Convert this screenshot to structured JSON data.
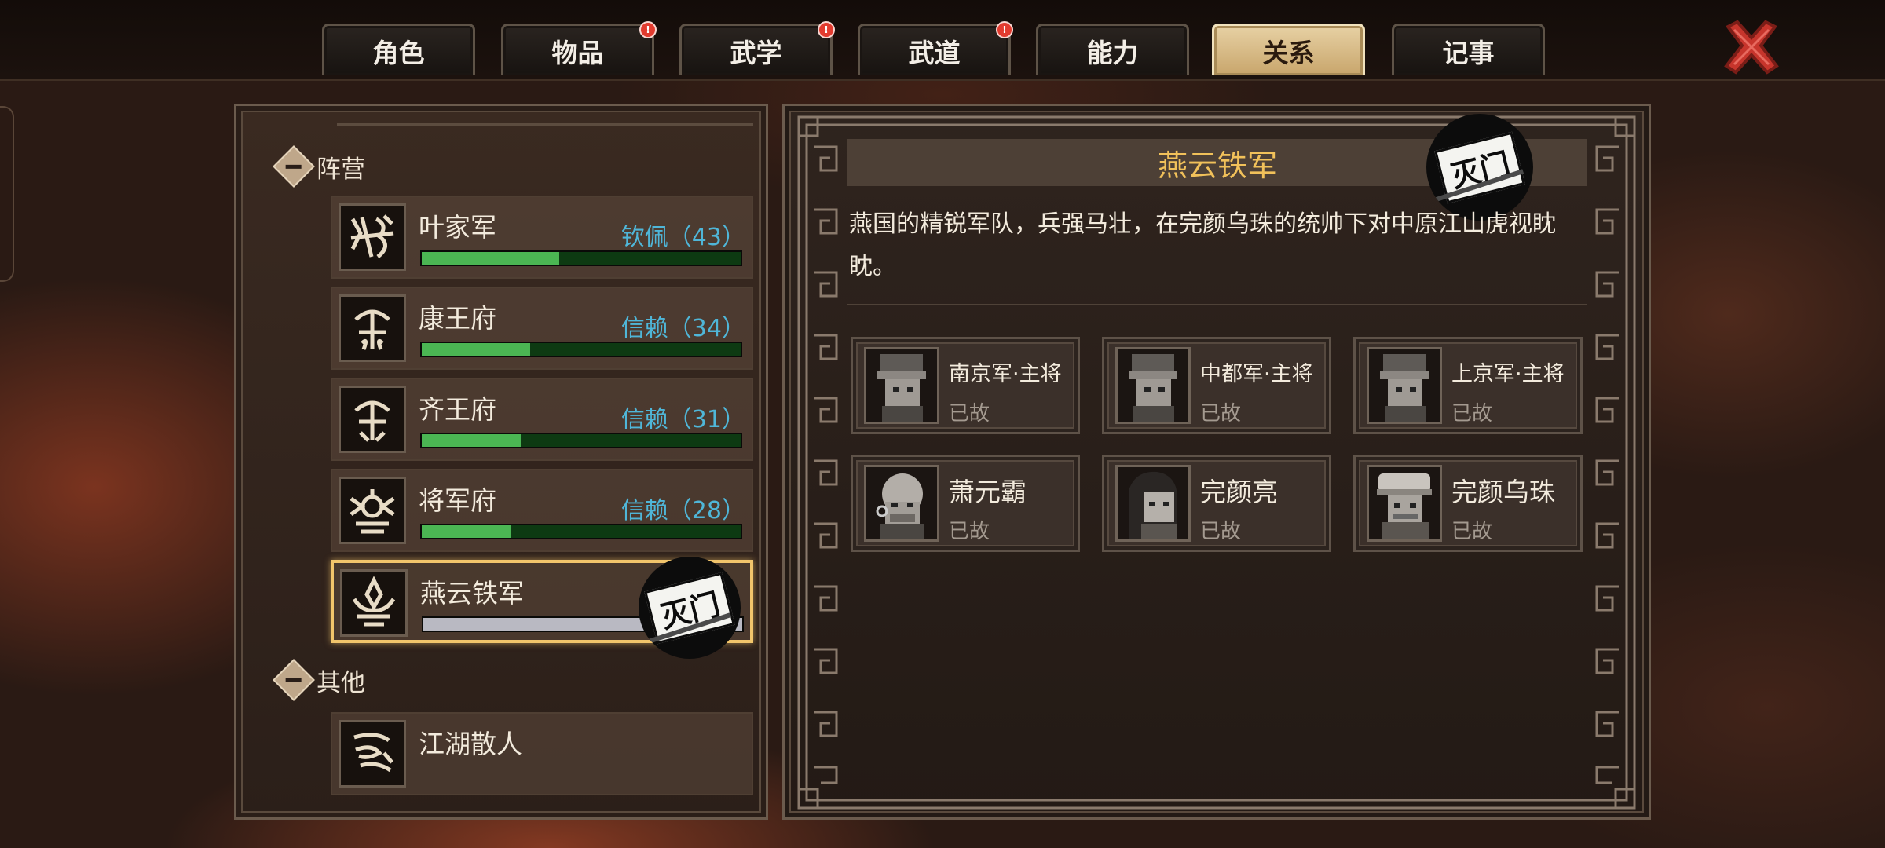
{
  "tabs": [
    {
      "label": "角色",
      "badge": false,
      "active": false
    },
    {
      "label": "物品",
      "badge": true,
      "active": false
    },
    {
      "label": "武学",
      "badge": true,
      "active": false
    },
    {
      "label": "武道",
      "badge": true,
      "active": false
    },
    {
      "label": "能力",
      "badge": false,
      "active": false
    },
    {
      "label": "关系",
      "badge": false,
      "active": true
    },
    {
      "label": "记事",
      "badge": false,
      "active": false
    }
  ],
  "badge_text": "!",
  "close_icon": "close-x-icon",
  "sections": {
    "factions_label": "阵营",
    "others_label": "其他"
  },
  "factions": [
    {
      "name": "叶家军",
      "standing": "钦佩（43）",
      "progress": 0.43,
      "emblem": "ye-family-army-emblem"
    },
    {
      "name": "康王府",
      "standing": "信赖（34）",
      "progress": 0.34,
      "emblem": "prince-kang-emblem"
    },
    {
      "name": "齐王府",
      "standing": "信赖（31）",
      "progress": 0.31,
      "emblem": "prince-qi-emblem"
    },
    {
      "name": "将军府",
      "standing": "信赖（28）",
      "progress": 0.28,
      "emblem": "general-mansion-emblem"
    },
    {
      "name": "燕云铁军",
      "standing": "",
      "progress": 1.0,
      "emblem": "yanyun-army-emblem",
      "stamp": "灭门",
      "selected": true
    }
  ],
  "others": [
    {
      "name": "江湖散人",
      "emblem": "wanderer-emblem"
    }
  ],
  "detail": {
    "title": "燕云铁军",
    "stamp": "灭门",
    "description": "燕国的精锐军队，兵强马壮，在完颜乌珠的统帅下对中原江山虎视眈眈。",
    "members": [
      {
        "name": "南京军·主将",
        "status": "已故"
      },
      {
        "name": "中都军·主将",
        "status": "已故"
      },
      {
        "name": "上京军·主将",
        "status": "已故"
      },
      {
        "name": "萧元霸",
        "status": "已故"
      },
      {
        "name": "完颜亮",
        "status": "已故"
      },
      {
        "name": "完颜乌珠",
        "status": "已故"
      }
    ]
  },
  "colors": {
    "accent_gold": "#f1c15a",
    "standing_blue": "#4fb6d8",
    "bar_green": "#4bb653",
    "selected_border": "#f2c56b",
    "badge_red": "#e23b2f"
  }
}
